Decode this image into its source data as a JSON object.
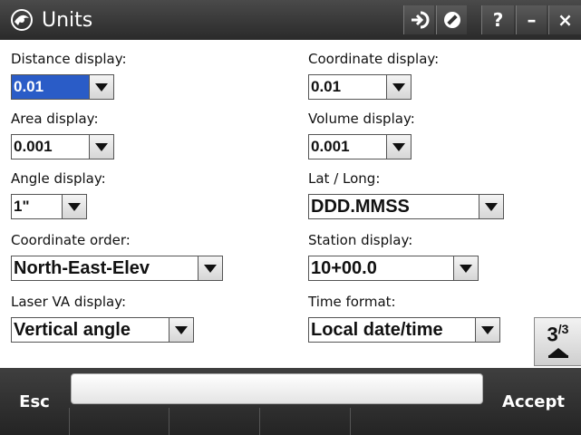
{
  "window": {
    "title": "Units",
    "buttons": [
      {
        "name": "login-arrow-icon",
        "label": ""
      },
      {
        "name": "no-entry-icon",
        "label": ""
      },
      {
        "name": "help-button",
        "label": "?"
      },
      {
        "name": "minimize-button",
        "label": "–"
      },
      {
        "name": "close-button",
        "label": "×"
      }
    ]
  },
  "fields": {
    "distance_display": {
      "label": "Distance display:",
      "value": "0.01"
    },
    "coordinate_display": {
      "label": "Coordinate display:",
      "value": "0.01"
    },
    "area_display": {
      "label": "Area display:",
      "value": "0.001"
    },
    "volume_display": {
      "label": "Volume display:",
      "value": "0.001"
    },
    "angle_display": {
      "label": "Angle display:",
      "value": "1\""
    },
    "lat_long": {
      "label": "Lat / Long:",
      "value": "DDD.MMSS"
    },
    "coordinate_order": {
      "label": "Coordinate order:",
      "value": "North-East-Elev"
    },
    "station_display": {
      "label": "Station display:",
      "value": "10+00.0"
    },
    "laser_va_display": {
      "label": "Laser VA display:",
      "value": "Vertical angle"
    },
    "time_format": {
      "label": "Time format:",
      "value": "Local date/time"
    }
  },
  "page_indicator": {
    "current": "3",
    "total": "3"
  },
  "softkeys": {
    "esc": "Esc",
    "accept": "Accept"
  },
  "colors": {
    "selection": "#2a5cc7",
    "titlebar": "#3a3a3a"
  }
}
